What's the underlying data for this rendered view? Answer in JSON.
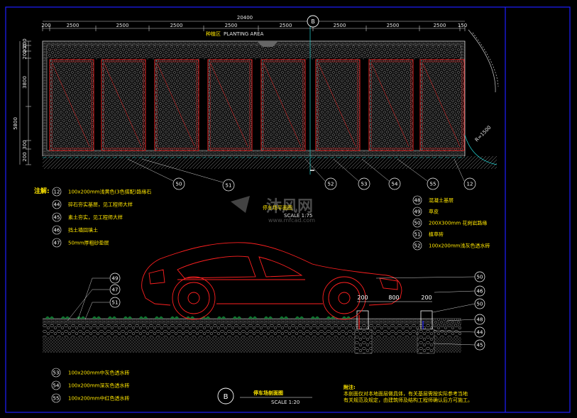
{
  "top_plan": {
    "overall_dim": "20400",
    "top_dims": [
      "200",
      "2500",
      "2500",
      "2500",
      "2500",
      "2500",
      "2500",
      "2500",
      "2500",
      "150"
    ],
    "left_dims": [
      "200",
      "200",
      "200",
      "3800",
      "5800",
      "300",
      "200"
    ],
    "section_marker_label": "B",
    "area_label_cn": "种植区",
    "area_label_en": "PLANTING AREA",
    "radius_label": "R=1500",
    "callouts": [
      "50",
      "51",
      "52",
      "53",
      "54",
      "55",
      "12"
    ],
    "title_cn": "停车场平面图",
    "title_scale": "SCALE 1:75"
  },
  "notes": {
    "heading": "注解:",
    "left": [
      {
        "num": "12",
        "text": "100x200mm浅黄色(3色搭配)路缘石"
      },
      {
        "num": "44",
        "text": "碎石夯实基层，见工程师大样"
      },
      {
        "num": "45",
        "text": "素土夯实，见工程师大样"
      },
      {
        "num": "46",
        "text": "挡土墙回填土"
      },
      {
        "num": "47",
        "text": "50mm厚粗砂垫层"
      }
    ],
    "right": [
      {
        "num": "48",
        "text": "混凝土基层"
      },
      {
        "num": "49",
        "text": "草皮"
      },
      {
        "num": "50",
        "text": "200X300mm 花岗岩路缘"
      },
      {
        "num": "51",
        "text": "植草砖"
      },
      {
        "num": "52",
        "text": "100x200mm浅灰色透水砖"
      }
    ]
  },
  "watermark": {
    "brand": "沐风网",
    "url": "www.mfcad.com"
  },
  "section": {
    "left_callouts": [
      "49",
      "47",
      "51"
    ],
    "right_callouts": [
      "50",
      "46",
      "50",
      "48",
      "44",
      "45"
    ],
    "dims": [
      "200",
      "800",
      "200"
    ],
    "marker": "B",
    "title_cn": "停车场剖面图",
    "scale": "SCALE   1:20"
  },
  "legend_bottom": [
    {
      "num": "53",
      "text": "100x200mm中灰色透水砖"
    },
    {
      "num": "54",
      "text": "100x200mm深灰色透水砖"
    },
    {
      "num": "55",
      "text": "100x200mm中红色透水砖"
    }
  ],
  "remark": {
    "heading": "附注:",
    "line1": "本剖面仅对本地面层做具体，有关基层需按实际参考当地",
    "line2": "有关规范及规定，由建筑师及结构工程师确认后方可施工。"
  },
  "colors": {
    "background": "#000000",
    "frame": "#1e1eff",
    "red": "#ff2020",
    "yellow": "#ffe600",
    "cyan": "#22d3d3",
    "white": "#ffffff"
  }
}
